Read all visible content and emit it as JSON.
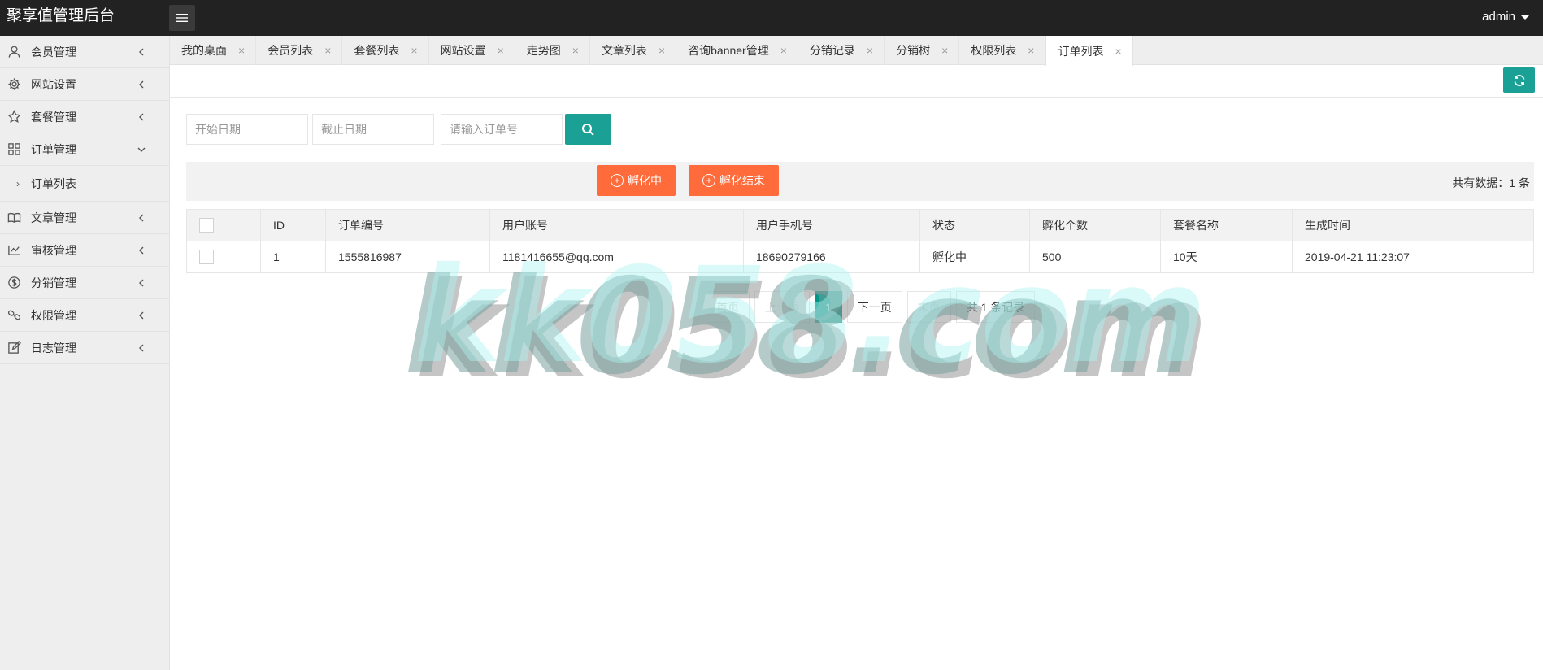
{
  "app": {
    "title": "聚享值管理后台",
    "user": "admin",
    "accent_color": "#1aa094",
    "warning_color": "#ff6b3a"
  },
  "sidebar": {
    "items": [
      {
        "label": "会员管理",
        "icon": "user-icon"
      },
      {
        "label": "网站设置",
        "icon": "gear-icon"
      },
      {
        "label": "套餐管理",
        "icon": "star-icon"
      },
      {
        "label": "订单管理",
        "icon": "grid-icon",
        "expanded": true
      },
      {
        "label": "文章管理",
        "icon": "book-icon"
      },
      {
        "label": "审核管理",
        "icon": "review-icon"
      },
      {
        "label": "分销管理",
        "icon": "dollar-icon"
      },
      {
        "label": "权限管理",
        "icon": "link-icon"
      },
      {
        "label": "日志管理",
        "icon": "edit-icon"
      }
    ],
    "sub_item": {
      "label": "订单列表"
    }
  },
  "tabs": [
    {
      "label": "我的桌面"
    },
    {
      "label": "会员列表"
    },
    {
      "label": "套餐列表"
    },
    {
      "label": "网站设置"
    },
    {
      "label": "走势图"
    },
    {
      "label": "文章列表"
    },
    {
      "label": "咨询banner管理"
    },
    {
      "label": "分销记录"
    },
    {
      "label": "分销树"
    },
    {
      "label": "权限列表"
    },
    {
      "label": "订单列表",
      "active": true
    }
  ],
  "tab_close_symbol": "×",
  "search": {
    "start_placeholder": "开始日期",
    "end_placeholder": "截止日期",
    "order_placeholder": "请输入订单号"
  },
  "actions": {
    "btn_incubating": "孵化中",
    "btn_incubate_end": "孵化结束",
    "total_text": "共有数据：1 条"
  },
  "table": {
    "headers": [
      "ID",
      "订单编号",
      "用户账号",
      "用户手机号",
      "状态",
      "孵化个数",
      "套餐名称",
      "生成时间"
    ],
    "rows": [
      [
        "1",
        "1555816987",
        "1181416655@qq.com",
        "18690279166",
        "孵化中",
        "500",
        "10天",
        "2019-04-21 11:23:07"
      ]
    ]
  },
  "pagination": {
    "first": "首页",
    "prev": "上一页",
    "current": "1",
    "next": "下一页",
    "last": "末页",
    "summary": "共 1 条记录"
  },
  "watermark": "kk058.com"
}
